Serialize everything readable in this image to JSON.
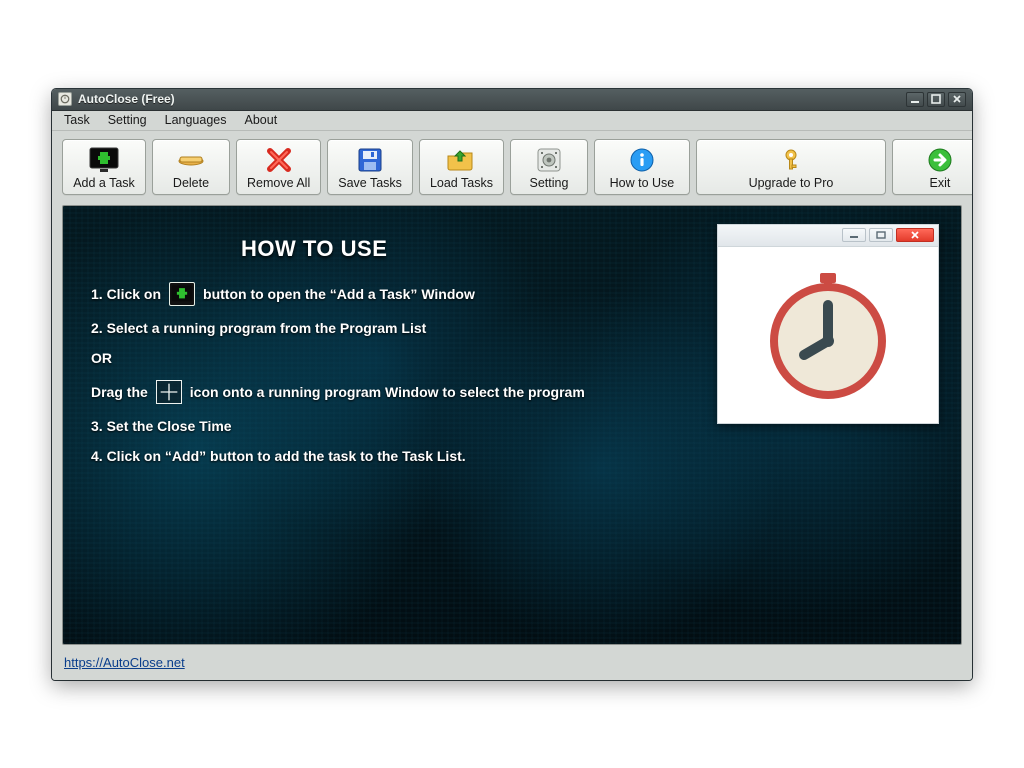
{
  "window": {
    "title": "AutoClose (Free)"
  },
  "menu": {
    "task": "Task",
    "setting": "Setting",
    "languages": "Languages",
    "about": "About"
  },
  "toolbar": {
    "addTask": "Add a Task",
    "delete": "Delete",
    "removeAll": "Remove All",
    "saveTasks": "Save Tasks",
    "loadTasks": "Load Tasks",
    "setting": "Setting",
    "howToUse": "How to Use",
    "upgrade": "Upgrade to Pro",
    "exit": "Exit"
  },
  "howto": {
    "heading": "HOW TO USE",
    "step1a": "1. Click on",
    "step1b": "button to open the “Add a Task” Window",
    "step2": "2. Select a running program from the Program List",
    "or": "OR",
    "dragA": "Drag the",
    "dragB": "icon onto a running program Window to select the program",
    "step3": "3. Set the Close Time",
    "step4": "4. Click on “Add” button to add the task to the Task List."
  },
  "footer": {
    "url": "https://AutoClose.net"
  }
}
